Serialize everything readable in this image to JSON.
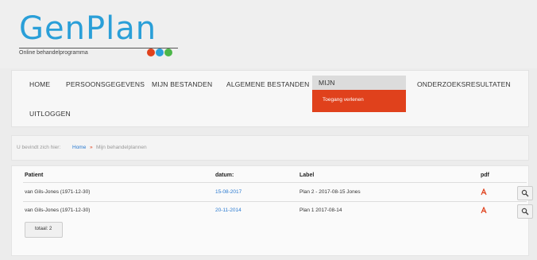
{
  "logo": {
    "brand": "GenPlan",
    "subtitle": "Online behandelprogramma",
    "dot_colors": [
      "#e0411c",
      "#2a9fd8",
      "#4cb648"
    ]
  },
  "nav": {
    "items": [
      {
        "label": "HOME"
      },
      {
        "label": "PERSOONSGEGEVENS"
      },
      {
        "label": "MIJN BESTANDEN"
      },
      {
        "label": "ALGEMENE BESTANDEN"
      },
      {
        "label": "MIJN BEHANDELPLANNEN"
      },
      {
        "label": "ONDERZOEKSRESULTATEN"
      },
      {
        "label": "UITLOGGEN"
      }
    ],
    "dropdown_item": "Toegang verlenen",
    "accent": "#e0411c"
  },
  "breadcrumb": {
    "prefix": "U bevindt zich hier:",
    "home": "Home",
    "separator": "»",
    "current": "Mijn behandelplannen"
  },
  "table": {
    "headers": [
      "Patient",
      "datum:",
      "Label",
      "pdf"
    ],
    "rows": [
      {
        "patient": "van Gils-Jones (1971-12-30)",
        "datum": "15-08-2017",
        "label": "Plan 2 - 2017-08-15 Jones"
      },
      {
        "patient": "van Gils-Jones (1971-12-30)",
        "datum": "20-11-2014",
        "label": "Plan 1 2017-08-14"
      }
    ],
    "total": "totaal: 2"
  }
}
